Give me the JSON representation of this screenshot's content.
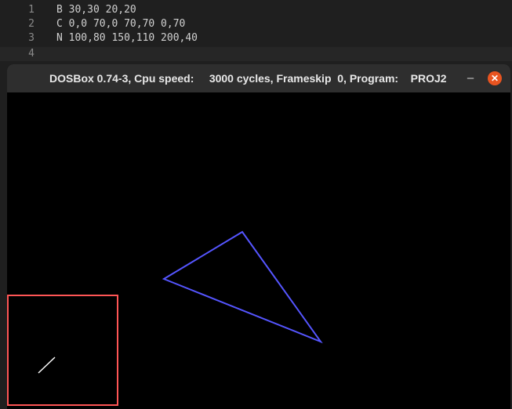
{
  "editor": {
    "lines": [
      {
        "number": "1",
        "text": "B 30,30 20,20"
      },
      {
        "number": "2",
        "text": "C 0,0 70,0 70,70 0,70"
      },
      {
        "number": "3",
        "text": "N 100,80 150,110 200,40"
      },
      {
        "number": "4",
        "text": ""
      }
    ]
  },
  "window": {
    "title": "DOSBox 0.74-3, Cpu speed:     3000 cycles, Frameskip  0, Program:    PROJ2",
    "minimize_glyph": "–",
    "close_glyph": "✕"
  },
  "screen": {
    "background_color": "#000000",
    "line_color": "#ffffff",
    "square_color": "#ff5555",
    "polygon_color": "#5555ff"
  }
}
